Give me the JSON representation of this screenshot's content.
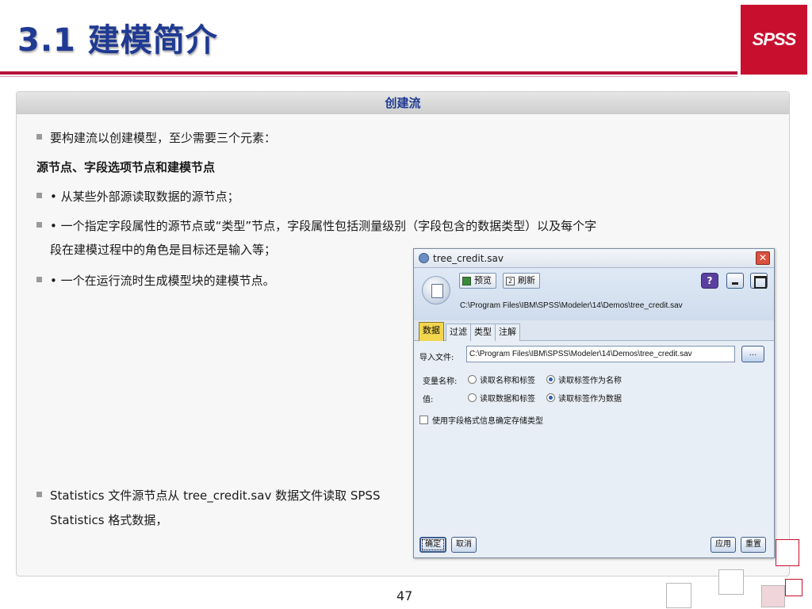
{
  "slide": {
    "title": "3.1 建模简介",
    "brand": "SPSS",
    "panel_header": "创建流",
    "bullets": [
      "要构建流以创建模型，至少需要三个元素：",
      "源节点、字段选项节点和建模节点",
      "• 从某些外部源读取数据的源节点；",
      "• 一个指定字段属性的源节点或“类型”节点，字段属性包括测量级别（字段包含的数据类型）以及每个字",
      "段在建模过程中的角色是目标还是输入等；",
      "• 一个在运行流时生成模型块的建模节点。",
      "Statistics 文件源节点从 tree_credit.sav 数据文件读取 SPSS",
      "Statistics 格式数据，"
    ],
    "page_number": "47"
  },
  "dialog": {
    "title": "tree_credit.sav",
    "close_label": "✕",
    "toolbar": {
      "preview_label": "预览",
      "refresh_label": "刷新",
      "help_label": "?"
    },
    "path": "C:\\Program Files\\IBM\\SPSS\\Modeler\\14\\Demos\\tree_credit.sav",
    "tabs": [
      "数据",
      "过滤",
      "类型",
      "注解"
    ],
    "active_tab": "数据",
    "import_file_label": "导入文件:",
    "import_file_value": "C:\\Program Files\\IBM\\SPSS\\Modeler\\14\\Demos\\tree_credit.sav",
    "browse_label": "...",
    "variable_names_label": "变量名称:",
    "variable_names_options": [
      "读取名称和标签",
      "读取标签作为名称"
    ],
    "variable_names_selected": "读取标签作为名称",
    "values_label": "值:",
    "values_options": [
      "读取数据和标签",
      "读取标签作为数据"
    ],
    "values_selected": "读取标签作为数据",
    "checkbox_label": "使用字段格式信息确定存储类型",
    "checkbox_checked": false,
    "buttons": {
      "ok": "确定",
      "cancel": "取消",
      "apply": "应用",
      "reset": "重置"
    }
  },
  "colors": {
    "title_blue": "#1f3a93",
    "brand_red": "#c8102e",
    "rule_red": "#b5123a",
    "active_tab_yellow": "#f2d64e"
  }
}
